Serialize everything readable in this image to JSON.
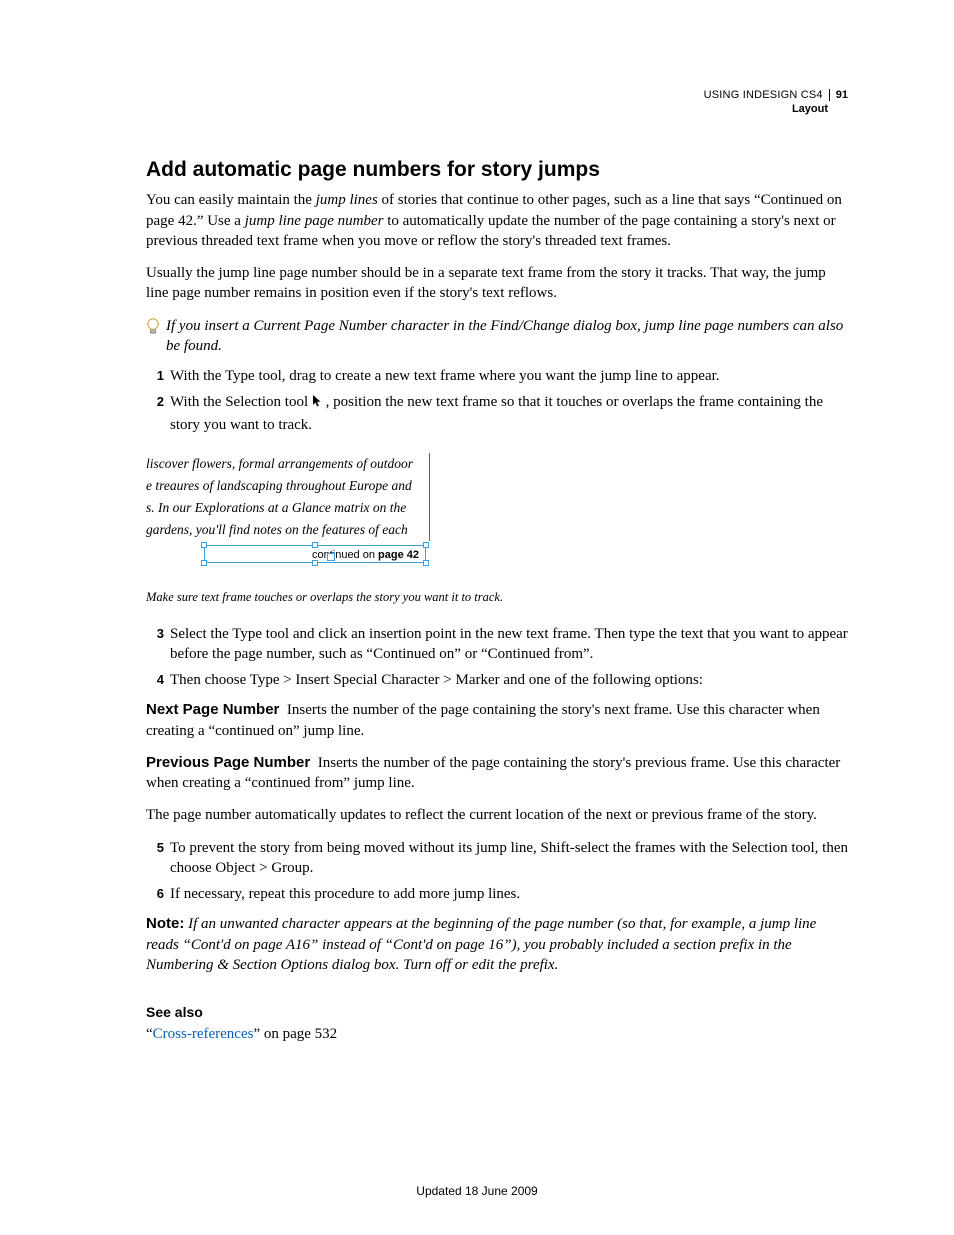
{
  "header": {
    "doc_title": "USING INDESIGN CS4",
    "section": "Layout",
    "page_number": "91"
  },
  "heading": "Add automatic page numbers for story jumps",
  "intro": {
    "p1a": "You can easily maintain the ",
    "p1_em1": "jump lines",
    "p1b": " of stories that continue to other pages, such as a line that says “Continued on page 42.” Use a ",
    "p1_em2": "jump line page number",
    "p1c": " to automatically update the number of the page containing a story's next or previous threaded text frame when you move or reflow the story's threaded text frames.",
    "p2": "Usually the jump line page number should be in a separate text frame from the story it tracks. That way, the jump line page number remains in position even if the story's text reflows."
  },
  "tip": "If you insert a Current Page Number character in the Find/Change dialog box, jump line page numbers can also be found.",
  "steps_a": {
    "n1": "1",
    "s1": "With the Type tool, drag to create a new text frame where you want the jump line to appear.",
    "n2": "2",
    "s2a": "With the Selection tool ",
    "s2b": " , position the new text frame so that it touches or overlaps the frame containing the story you want to track."
  },
  "figure": {
    "story_l1": "liscover flowers, formal arrangements of outdoor",
    "story_l2": "e treaures of landscaping throughout Europe and",
    "story_l3": "s. In our Explorations at a Glance matrix on the",
    "story_l4": "gardens, you'll find notes on the features of each",
    "jump_prefix": "continued on ",
    "jump_bold": "page 42",
    "caption": "Make sure text frame touches or overlaps the story you want it to track."
  },
  "steps_b": {
    "n3": "3",
    "s3": "Select the Type tool and click an insertion point in the new text frame. Then type the text that you want to appear before the page number, such as “Continued on” or “Continued from”.",
    "n4": "4",
    "s4": "Then choose Type > Insert Special Character > Marker and one of the following options:"
  },
  "defs": {
    "t1": "Next Page Number",
    "d1": "Inserts the number of the page containing the story's next frame. Use this character when creating a “continued on” jump line.",
    "t2": "Previous Page Number",
    "d2": "Inserts the number of the page containing the story's previous frame. Use this character when creating a “continued from” jump line."
  },
  "after_defs": "The page number automatically updates to reflect the current location of the next or previous frame of the story.",
  "steps_c": {
    "n5": "5",
    "s5": "To prevent the story from being moved without its jump line, Shift-select the frames with the Selection tool, then choose Object > Group.",
    "n6": "6",
    "s6": "If necessary, repeat this procedure to add more jump lines."
  },
  "note": {
    "label": "Note:",
    "text": " If an unwanted character appears at the beginning of the page number (so that, for example, a jump line reads “Cont'd on page A16” instead of “Cont'd on page 16”), you probably included a section prefix in the Numbering & Section Options dialog box. Turn off or edit the prefix."
  },
  "see_also": {
    "heading": "See also",
    "q1": "“",
    "link": "Cross-references",
    "q2": "” on page 532"
  },
  "footer": "Updated 18 June 2009"
}
